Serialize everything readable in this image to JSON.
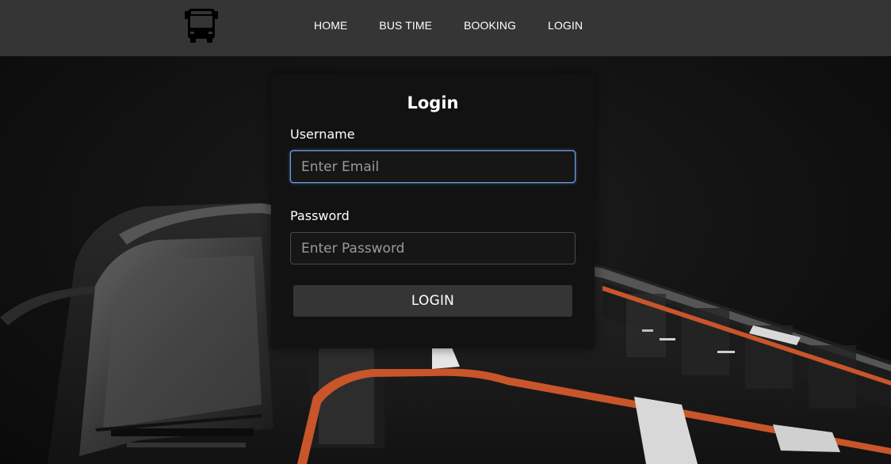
{
  "nav": {
    "logo_icon": "bus-icon",
    "links": [
      {
        "label": "HOME"
      },
      {
        "label": "BUS TIME"
      },
      {
        "label": "BOOKING"
      },
      {
        "label": "LOGIN"
      }
    ]
  },
  "login_form": {
    "title": "Login",
    "username_label": "Username",
    "username_placeholder": "Enter Email",
    "username_value": "",
    "password_label": "Password",
    "password_placeholder": "Enter Password",
    "password_value": "",
    "submit_label": "LOGIN"
  },
  "colors": {
    "navbar": "#353535",
    "card": "#121212",
    "button": "#353535",
    "bus_accent": "#c9552a",
    "focus_border": "#6f9fe0"
  }
}
